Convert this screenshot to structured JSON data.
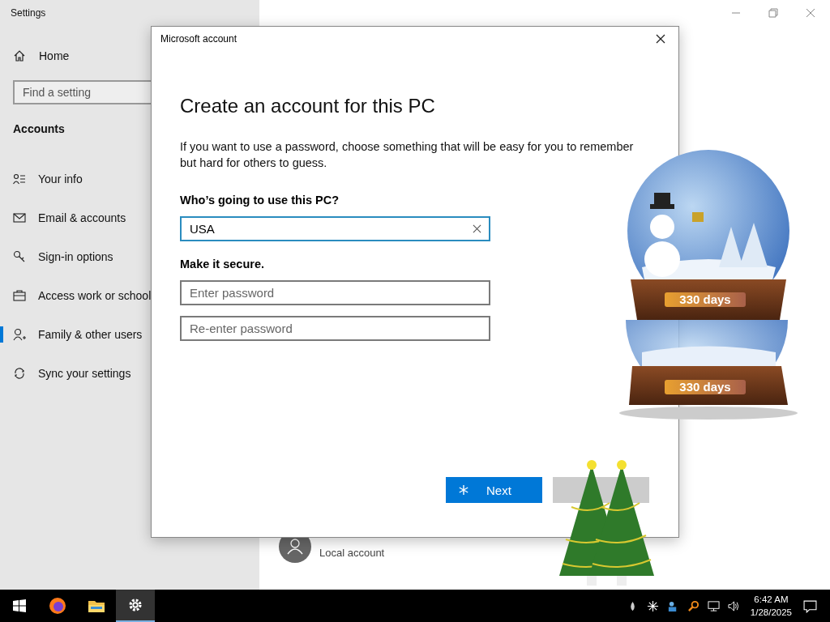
{
  "settings_window": {
    "title": "Settings"
  },
  "sidebar": {
    "home": "Home",
    "search": {
      "placeholder": "Find a setting"
    },
    "section": "Accounts",
    "items": [
      {
        "label": "Your info",
        "selected": false
      },
      {
        "label": "Email & accounts",
        "selected": false
      },
      {
        "label": "Sign-in options",
        "selected": false
      },
      {
        "label": "Access work or school",
        "selected": false
      },
      {
        "label": "Family & other users",
        "selected": true
      },
      {
        "label": "Sync your settings",
        "selected": false
      }
    ]
  },
  "content": {
    "account": {
      "subtitle": "Local account"
    }
  },
  "dialog": {
    "title": "Microsoft account",
    "heading": "Create an account for this PC",
    "description": "If you want to use a password, choose something that will be easy for you to remember but hard for others to guess.",
    "name_label": "Who’s going to use this PC?",
    "name_field": {
      "value": "USA"
    },
    "secure_label": "Make it secure.",
    "password_fields": [
      {
        "placeholder": "Enter password"
      },
      {
        "placeholder": "Re-enter password"
      }
    ],
    "next_button": "Next"
  },
  "gadget": {
    "labels": [
      "330 days",
      "330 days"
    ]
  },
  "taskbar": {
    "apps": [
      {
        "selected": false
      },
      {
        "selected": false
      },
      {
        "selected": true
      }
    ],
    "clock": {
      "time": "6:42 AM",
      "date": "1/28/2025"
    }
  }
}
